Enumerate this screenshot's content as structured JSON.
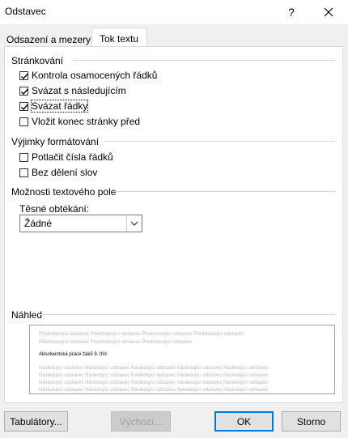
{
  "window": {
    "title": "Odstavec",
    "help_label": "?"
  },
  "tabs": [
    {
      "label": "Odsazení a mezery",
      "active": false
    },
    {
      "label": "Tok textu",
      "active": true
    }
  ],
  "pagination": {
    "heading": "Stránkování",
    "options": [
      {
        "label": "Kontrola osamocených řádků",
        "checked": true
      },
      {
        "label": "Svázat s následujícím",
        "checked": true
      },
      {
        "label": "Svázat řádky",
        "checked": true
      },
      {
        "label": "Vložit konec stránky před",
        "checked": false
      }
    ]
  },
  "exceptions": {
    "heading": "Výjimky formátování",
    "options": [
      {
        "label": "Potlačit čísla řádků",
        "checked": false
      },
      {
        "label": "Bez dělení slov",
        "checked": false
      }
    ]
  },
  "textbox": {
    "heading": "Možnosti textového pole",
    "wrap_label": "Těsné obtékání:",
    "wrap_value": "Žádné"
  },
  "preview": {
    "heading": "Náhled",
    "prev_lines": [
      "Předcházející odstavec Předcházející odstavec Předcházející odstavec Předcházející odstavec",
      "Předcházející odstavec Předcházející odstavec Předcházející odstavec"
    ],
    "main_text": "Absolventská práce žáků 9. tříd",
    "next_lines": [
      "Následující odstavec Následující odstavec Následující odstavec Následující odstavec Následující odstavec",
      "Následující odstavec Následující odstavec Následující odstavec Následující odstavec Následující odstavec",
      "Následující odstavec Následující odstavec Následující odstavec Následující odstavec Následující odstavec",
      "Následující odstavec Následující odstavec Následující odstavec Následující odstavec Následující odstavec"
    ]
  },
  "buttons": {
    "tabs_label": "Tabulátory...",
    "default_label": "Výchozí...",
    "ok_label": "OK",
    "cancel_label": "Storno"
  },
  "colors": {
    "accent": "#0078d7",
    "window_bg": "#f0f0f0"
  }
}
